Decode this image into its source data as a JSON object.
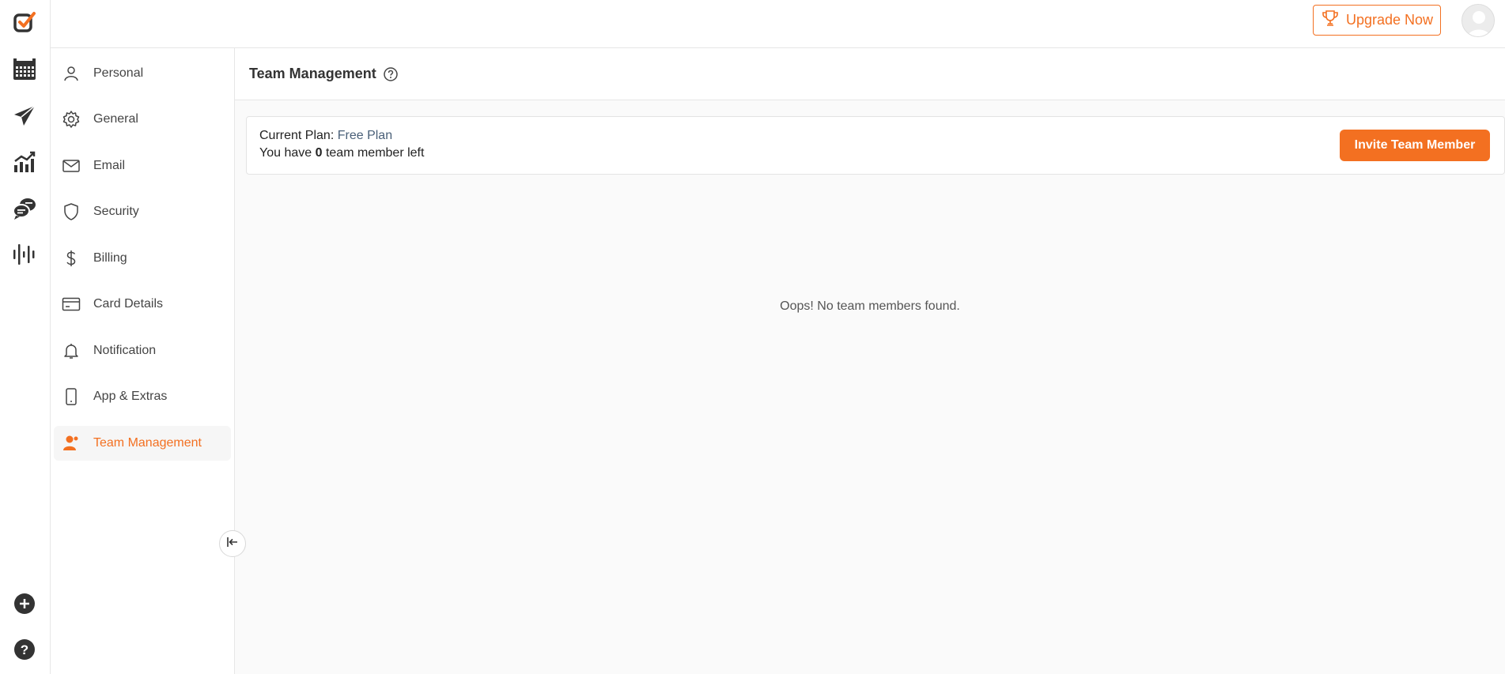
{
  "rail": {
    "icons": [
      "logo-check-icon",
      "calendar-icon",
      "paper-plane-icon",
      "analytics-icon",
      "chat-bubbles-icon",
      "audio-waveform-icon",
      "plus-circle-icon",
      "help-circle-icon"
    ]
  },
  "topbar": {
    "upgrade_label": "Upgrade Now"
  },
  "sidebar": {
    "items": [
      {
        "label": "Personal",
        "icon": "user-icon"
      },
      {
        "label": "General",
        "icon": "gear-icon"
      },
      {
        "label": "Email",
        "icon": "envelope-icon"
      },
      {
        "label": "Security",
        "icon": "shield-icon"
      },
      {
        "label": "Billing",
        "icon": "dollar-icon"
      },
      {
        "label": "Card Details",
        "icon": "credit-card-icon"
      },
      {
        "label": "Notification",
        "icon": "bell-icon"
      },
      {
        "label": "App & Extras",
        "icon": "mobile-icon"
      },
      {
        "label": "Team Management",
        "icon": "team-user-icon",
        "active": true
      }
    ]
  },
  "main": {
    "title": "Team Management",
    "plan": {
      "label": "Current Plan:",
      "value": "Free Plan",
      "members_prefix": "You have",
      "members_count": "0",
      "members_suffix": "team member left"
    },
    "invite_label": "Invite Team Member",
    "empty_message": "Oops! No team members found."
  },
  "colors": {
    "accent": "#f37021",
    "text": "#333333",
    "plan_value": "#4a6078",
    "background": "#fafafa"
  }
}
